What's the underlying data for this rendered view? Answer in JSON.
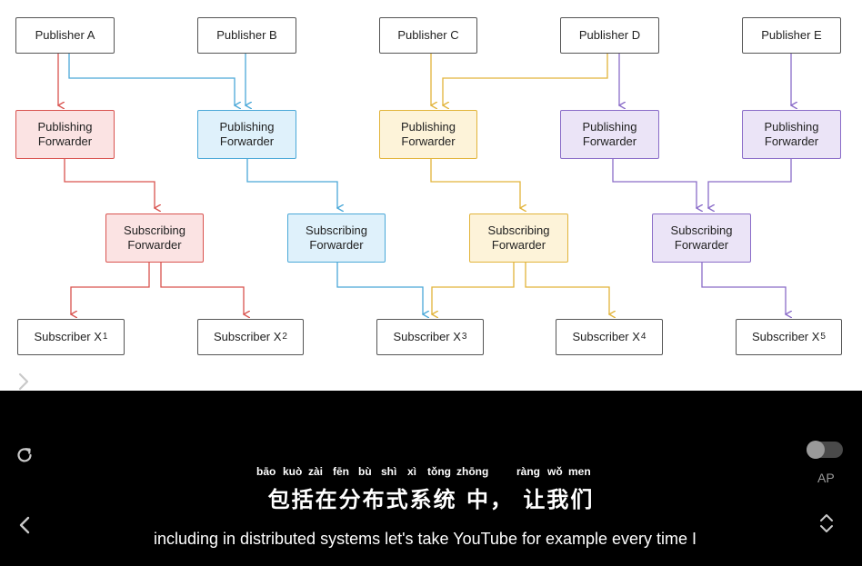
{
  "diagram": {
    "colors": {
      "red": "#d9534f",
      "blue": "#4aa8d8",
      "yellow": "#e2b43a",
      "purple": "#8a6cc8",
      "neutral": "#555555"
    },
    "publishers": [
      "Publisher A",
      "Publisher B",
      "Publisher C",
      "Publisher D",
      "Publisher E"
    ],
    "publishing_forwarders": [
      "Publishing\nForwarder",
      "Publishing\nForwarder",
      "Publishing\nForwarder",
      "Publishing\nForwarder",
      "Publishing\nForwarder"
    ],
    "subscribing_forwarders": [
      "Subscribing\nForwarder",
      "Subscribing\nForwarder",
      "Subscribing\nForwarder",
      "Subscribing\nForwarder"
    ],
    "subscribers": [
      {
        "label": "Subscriber X",
        "index": "1"
      },
      {
        "label": "Subscriber X",
        "index": "2"
      },
      {
        "label": "Subscriber X",
        "index": "3"
      },
      {
        "label": "Subscriber X",
        "index": "4"
      },
      {
        "label": "Subscriber X",
        "index": "5"
      }
    ]
  },
  "player": {
    "toggle_label": "AP",
    "icons": {
      "expand": "chevron-right-icon",
      "reload": "reload-icon",
      "previous": "chevron-left-icon",
      "updown": "up-down-chevron-icon"
    }
  },
  "subtitles": {
    "pinyin": [
      "bāo",
      "kuò",
      "zài",
      "fēn",
      "bù",
      "shì",
      "xì",
      "tǒng",
      "zhōng",
      "ràng",
      "wǒ",
      "men"
    ],
    "chinese": "包括在分布式系统 中， 让我们",
    "english": "including in distributed systems let's take YouTube for example every time I"
  }
}
